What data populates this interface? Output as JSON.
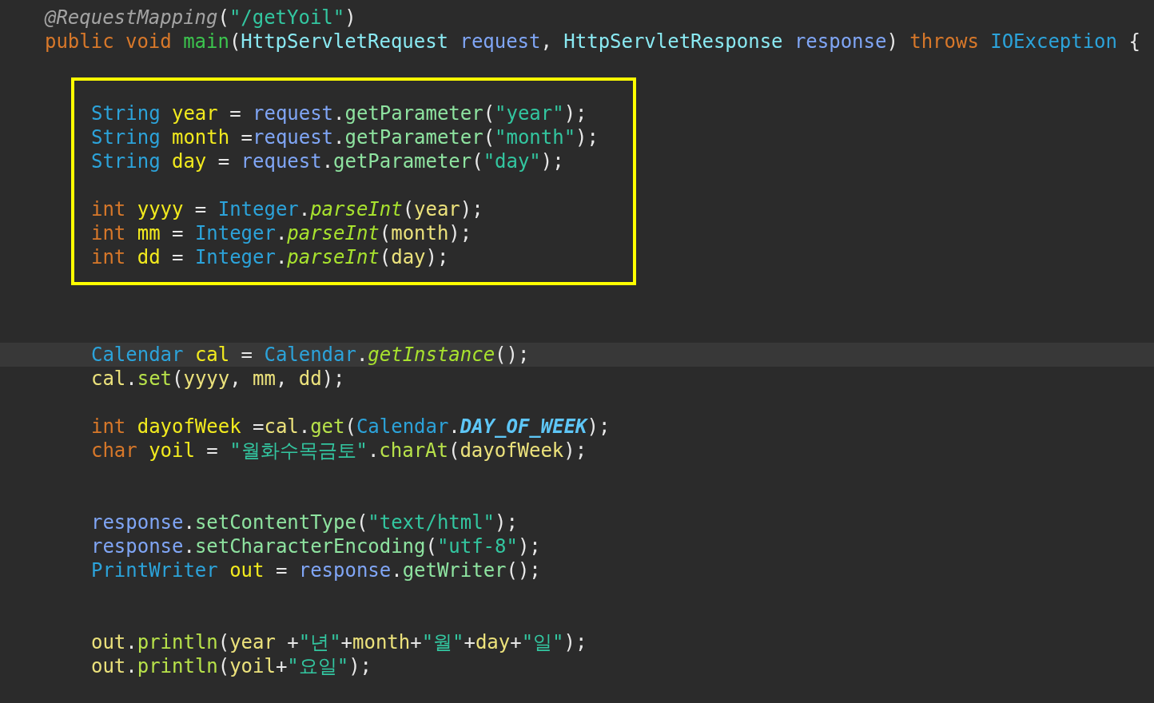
{
  "editor": {
    "sections": [
      {
        "kind": "code",
        "groups": [
          {
            "kind": "member",
            "lines": [
              {
                "current": false,
                "tokens": [
                  {
                    "kind": "annotation",
                    "text": "@RequestMapping"
                  },
                  {
                    "kind": "punct",
                    "text": "("
                  },
                  {
                    "kind": "string",
                    "text": "\"/getYoil\""
                  },
                  {
                    "kind": "punct",
                    "text": ")"
                  }
                ]
              },
              {
                "current": false,
                "tokens": [
                  {
                    "kind": "keyword",
                    "text": "public void "
                  },
                  {
                    "kind": "method_decl",
                    "text": "main"
                  },
                  {
                    "kind": "punct",
                    "text": "("
                  },
                  {
                    "kind": "type_param",
                    "text": "HttpServletRequest "
                  },
                  {
                    "kind": "param",
                    "text": "request"
                  },
                  {
                    "kind": "punct",
                    "text": ", "
                  },
                  {
                    "kind": "type_param",
                    "text": "HttpServletResponse "
                  },
                  {
                    "kind": "param",
                    "text": "response"
                  },
                  {
                    "kind": "punct",
                    "text": ") "
                  },
                  {
                    "kind": "keyword",
                    "text": "throws "
                  },
                  {
                    "kind": "type",
                    "text": "IOException"
                  },
                  {
                    "kind": "punct",
                    "text": " {"
                  }
                ]
              }
            ]
          }
        ]
      },
      {
        "kind": "highlight_box",
        "groups": [
          {
            "kind": "body",
            "lines": [
              {
                "current": false,
                "tokens": [
                  {
                    "kind": "type",
                    "text": "String "
                  },
                  {
                    "kind": "local",
                    "text": "year"
                  },
                  {
                    "kind": "punct",
                    "text": " = "
                  },
                  {
                    "kind": "param",
                    "text": "request"
                  },
                  {
                    "kind": "punct",
                    "text": "."
                  },
                  {
                    "kind": "method",
                    "text": "getParameter"
                  },
                  {
                    "kind": "punct",
                    "text": "("
                  },
                  {
                    "kind": "string",
                    "text": "\"year\""
                  },
                  {
                    "kind": "punct",
                    "text": ");"
                  }
                ]
              },
              {
                "current": false,
                "tokens": [
                  {
                    "kind": "type",
                    "text": "String "
                  },
                  {
                    "kind": "local",
                    "text": "month"
                  },
                  {
                    "kind": "punct",
                    "text": " ="
                  },
                  {
                    "kind": "param",
                    "text": "request"
                  },
                  {
                    "kind": "punct",
                    "text": "."
                  },
                  {
                    "kind": "method",
                    "text": "getParameter"
                  },
                  {
                    "kind": "punct",
                    "text": "("
                  },
                  {
                    "kind": "string",
                    "text": "\"month\""
                  },
                  {
                    "kind": "punct",
                    "text": ");"
                  }
                ]
              },
              {
                "current": false,
                "tokens": [
                  {
                    "kind": "type",
                    "text": "String "
                  },
                  {
                    "kind": "local",
                    "text": "day"
                  },
                  {
                    "kind": "punct",
                    "text": " = "
                  },
                  {
                    "kind": "param",
                    "text": "request"
                  },
                  {
                    "kind": "punct",
                    "text": "."
                  },
                  {
                    "kind": "method",
                    "text": "getParameter"
                  },
                  {
                    "kind": "punct",
                    "text": "("
                  },
                  {
                    "kind": "string",
                    "text": "\"day\""
                  },
                  {
                    "kind": "punct",
                    "text": ");"
                  }
                ]
              }
            ]
          },
          {
            "kind": "body",
            "lines": [
              {
                "current": false,
                "tokens": [
                  {
                    "kind": "keyword",
                    "text": "int "
                  },
                  {
                    "kind": "local",
                    "text": "yyyy"
                  },
                  {
                    "kind": "punct",
                    "text": " = "
                  },
                  {
                    "kind": "type",
                    "text": "Integer"
                  },
                  {
                    "kind": "punct",
                    "text": "."
                  },
                  {
                    "kind": "static_method",
                    "text": "parseInt"
                  },
                  {
                    "kind": "punct",
                    "text": "("
                  },
                  {
                    "kind": "ref",
                    "text": "year"
                  },
                  {
                    "kind": "punct",
                    "text": ");"
                  }
                ]
              },
              {
                "current": false,
                "tokens": [
                  {
                    "kind": "keyword",
                    "text": "int "
                  },
                  {
                    "kind": "local",
                    "text": "mm"
                  },
                  {
                    "kind": "punct",
                    "text": " = "
                  },
                  {
                    "kind": "type",
                    "text": "Integer"
                  },
                  {
                    "kind": "punct",
                    "text": "."
                  },
                  {
                    "kind": "static_method",
                    "text": "parseInt"
                  },
                  {
                    "kind": "punct",
                    "text": "("
                  },
                  {
                    "kind": "ref",
                    "text": "month"
                  },
                  {
                    "kind": "punct",
                    "text": ");"
                  }
                ]
              },
              {
                "current": false,
                "tokens": [
                  {
                    "kind": "keyword",
                    "text": "int "
                  },
                  {
                    "kind": "local",
                    "text": "dd"
                  },
                  {
                    "kind": "punct",
                    "text": " = "
                  },
                  {
                    "kind": "type",
                    "text": "Integer"
                  },
                  {
                    "kind": "punct",
                    "text": "."
                  },
                  {
                    "kind": "static_method",
                    "text": "parseInt"
                  },
                  {
                    "kind": "punct",
                    "text": "("
                  },
                  {
                    "kind": "ref",
                    "text": "day"
                  },
                  {
                    "kind": "punct",
                    "text": ");"
                  }
                ]
              }
            ]
          }
        ]
      },
      {
        "kind": "code",
        "groups": [
          {
            "kind": "body",
            "lines": [
              {
                "current": true,
                "tokens": [
                  {
                    "kind": "type",
                    "text": "Calendar "
                  },
                  {
                    "kind": "local",
                    "text": "cal"
                  },
                  {
                    "kind": "punct",
                    "text": " = "
                  },
                  {
                    "kind": "type",
                    "text": "Calendar"
                  },
                  {
                    "kind": "punct",
                    "text": "."
                  },
                  {
                    "kind": "static_method",
                    "text": "getInstance"
                  },
                  {
                    "kind": "punct",
                    "text": "();"
                  }
                ]
              },
              {
                "current": false,
                "tokens": [
                  {
                    "kind": "ref",
                    "text": "cal"
                  },
                  {
                    "kind": "punct",
                    "text": "."
                  },
                  {
                    "kind": "method_alt",
                    "text": "set"
                  },
                  {
                    "kind": "punct",
                    "text": "("
                  },
                  {
                    "kind": "ref",
                    "text": "yyyy"
                  },
                  {
                    "kind": "punct",
                    "text": ", "
                  },
                  {
                    "kind": "ref",
                    "text": "mm"
                  },
                  {
                    "kind": "punct",
                    "text": ", "
                  },
                  {
                    "kind": "ref",
                    "text": "dd"
                  },
                  {
                    "kind": "punct",
                    "text": ");"
                  }
                ]
              }
            ]
          },
          {
            "kind": "body",
            "lines": [
              {
                "current": false,
                "tokens": [
                  {
                    "kind": "keyword",
                    "text": "int "
                  },
                  {
                    "kind": "local",
                    "text": "dayofWeek"
                  },
                  {
                    "kind": "punct",
                    "text": " ="
                  },
                  {
                    "kind": "ref",
                    "text": "cal"
                  },
                  {
                    "kind": "punct",
                    "text": "."
                  },
                  {
                    "kind": "method_alt",
                    "text": "get"
                  },
                  {
                    "kind": "punct",
                    "text": "("
                  },
                  {
                    "kind": "type",
                    "text": "Calendar"
                  },
                  {
                    "kind": "punct",
                    "text": "."
                  },
                  {
                    "kind": "constant",
                    "text": "DAY_OF_WEEK"
                  },
                  {
                    "kind": "punct",
                    "text": ");"
                  }
                ]
              },
              {
                "current": false,
                "tokens": [
                  {
                    "kind": "keyword",
                    "text": "char "
                  },
                  {
                    "kind": "local",
                    "text": "yoil"
                  },
                  {
                    "kind": "punct",
                    "text": " = "
                  },
                  {
                    "kind": "string",
                    "text": "\"월화수목금토\""
                  },
                  {
                    "kind": "punct",
                    "text": "."
                  },
                  {
                    "kind": "method_alt",
                    "text": "charAt"
                  },
                  {
                    "kind": "punct",
                    "text": "("
                  },
                  {
                    "kind": "ref",
                    "text": "dayofWeek"
                  },
                  {
                    "kind": "punct",
                    "text": ");"
                  }
                ]
              }
            ]
          },
          {
            "kind": "body",
            "lines": [
              {
                "current": false,
                "tokens": [
                  {
                    "kind": "param",
                    "text": "response"
                  },
                  {
                    "kind": "punct",
                    "text": "."
                  },
                  {
                    "kind": "method",
                    "text": "setContentType"
                  },
                  {
                    "kind": "punct",
                    "text": "("
                  },
                  {
                    "kind": "string",
                    "text": "\"text/html\""
                  },
                  {
                    "kind": "punct",
                    "text": ");"
                  }
                ]
              },
              {
                "current": false,
                "tokens": [
                  {
                    "kind": "param",
                    "text": "response"
                  },
                  {
                    "kind": "punct",
                    "text": "."
                  },
                  {
                    "kind": "method",
                    "text": "setCharacterEncoding"
                  },
                  {
                    "kind": "punct",
                    "text": "("
                  },
                  {
                    "kind": "string",
                    "text": "\"utf-8\""
                  },
                  {
                    "kind": "punct",
                    "text": ");"
                  }
                ]
              },
              {
                "current": false,
                "tokens": [
                  {
                    "kind": "type",
                    "text": "PrintWriter "
                  },
                  {
                    "kind": "local",
                    "text": "out"
                  },
                  {
                    "kind": "punct",
                    "text": " = "
                  },
                  {
                    "kind": "param",
                    "text": "response"
                  },
                  {
                    "kind": "punct",
                    "text": "."
                  },
                  {
                    "kind": "method",
                    "text": "getWriter"
                  },
                  {
                    "kind": "punct",
                    "text": "();"
                  }
                ]
              }
            ]
          },
          {
            "kind": "body",
            "lines": [
              {
                "current": false,
                "tokens": [
                  {
                    "kind": "ref",
                    "text": "out"
                  },
                  {
                    "kind": "punct",
                    "text": "."
                  },
                  {
                    "kind": "method_alt",
                    "text": "println"
                  },
                  {
                    "kind": "punct",
                    "text": "("
                  },
                  {
                    "kind": "ref",
                    "text": "year"
                  },
                  {
                    "kind": "punct",
                    "text": " +"
                  },
                  {
                    "kind": "string",
                    "text": "\"년\""
                  },
                  {
                    "kind": "punct",
                    "text": "+"
                  },
                  {
                    "kind": "ref",
                    "text": "month"
                  },
                  {
                    "kind": "punct",
                    "text": "+"
                  },
                  {
                    "kind": "string",
                    "text": "\"월\""
                  },
                  {
                    "kind": "punct",
                    "text": "+"
                  },
                  {
                    "kind": "ref",
                    "text": "day"
                  },
                  {
                    "kind": "punct",
                    "text": "+"
                  },
                  {
                    "kind": "string",
                    "text": "\"일\""
                  },
                  {
                    "kind": "punct",
                    "text": ");"
                  }
                ]
              },
              {
                "current": false,
                "tokens": [
                  {
                    "kind": "ref",
                    "text": "out"
                  },
                  {
                    "kind": "punct",
                    "text": "."
                  },
                  {
                    "kind": "method_alt",
                    "text": "println"
                  },
                  {
                    "kind": "punct",
                    "text": "("
                  },
                  {
                    "kind": "ref",
                    "text": "yoil"
                  },
                  {
                    "kind": "punct",
                    "text": "+"
                  },
                  {
                    "kind": "string",
                    "text": "\"요일\""
                  },
                  {
                    "kind": "punct",
                    "text": ");"
                  }
                ]
              }
            ]
          }
        ]
      }
    ]
  }
}
